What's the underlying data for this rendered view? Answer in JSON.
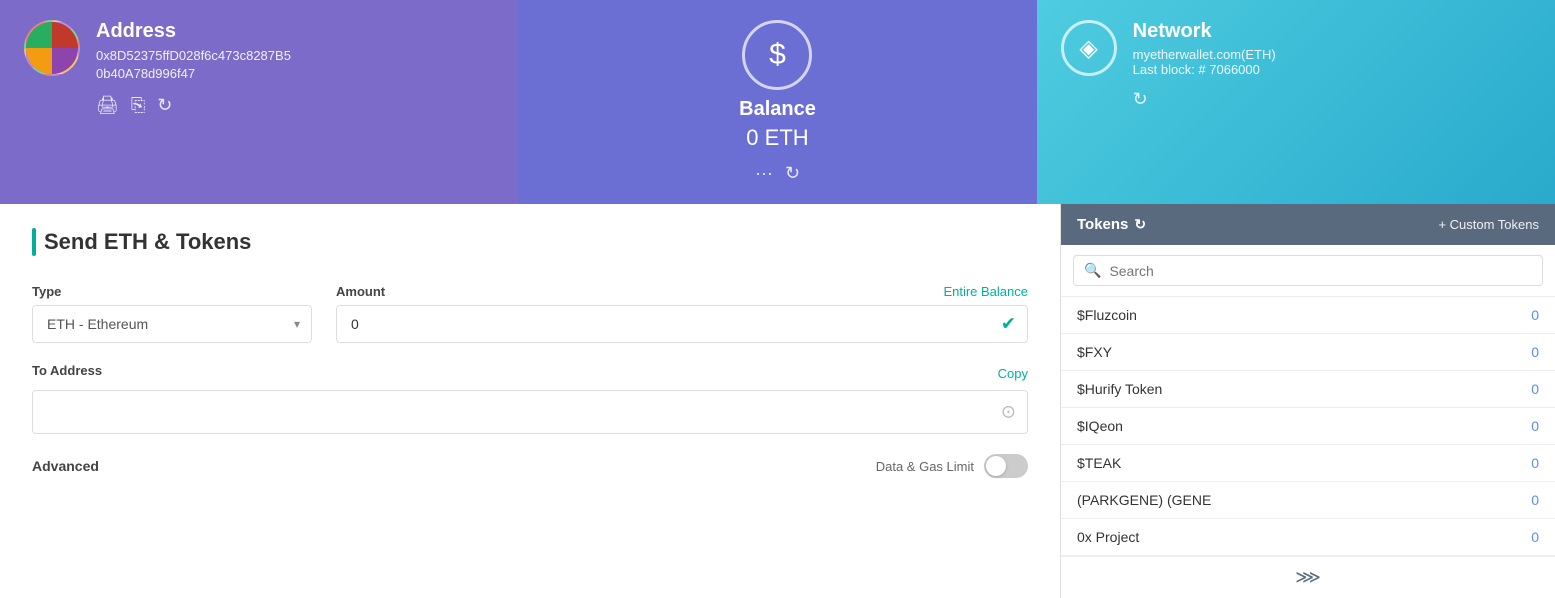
{
  "address_card": {
    "title": "Address",
    "address_line1": "0x8D52375ffD028f6c473c8287B5",
    "address_line2": "0b40A78d996f47",
    "icons": [
      "print-icon",
      "copy-icon",
      "refresh-icon"
    ]
  },
  "balance_card": {
    "title": "Balance",
    "value": "0",
    "currency": "ETH"
  },
  "network_card": {
    "title": "Network",
    "network_url": "myetherwallet.com(ETH)",
    "last_block": "Last block: # 7066000"
  },
  "send_panel": {
    "title": "Send ETH & Tokens",
    "type_label": "Type",
    "type_value": "ETH - Ethereum",
    "amount_label": "Amount",
    "amount_value": "0",
    "entire_balance": "Entire Balance",
    "to_address_label": "To Address",
    "copy_label": "Copy",
    "advanced_label": "Advanced",
    "gas_limit_label": "Data & Gas Limit"
  },
  "tokens_panel": {
    "title": "Tokens",
    "custom_tokens_label": "+ Custom Tokens",
    "search_placeholder": "Search",
    "tokens": [
      {
        "name": "$Fluzcoin",
        "balance": "0"
      },
      {
        "name": "$FXY",
        "balance": "0"
      },
      {
        "name": "$Hurify Token",
        "balance": "0"
      },
      {
        "name": "$IQeon",
        "balance": "0"
      },
      {
        "name": "$TEAK",
        "balance": "0"
      },
      {
        "name": "(PARKGENE) (GENE",
        "balance": "0"
      },
      {
        "name": "0x Project",
        "balance": "0"
      }
    ]
  }
}
